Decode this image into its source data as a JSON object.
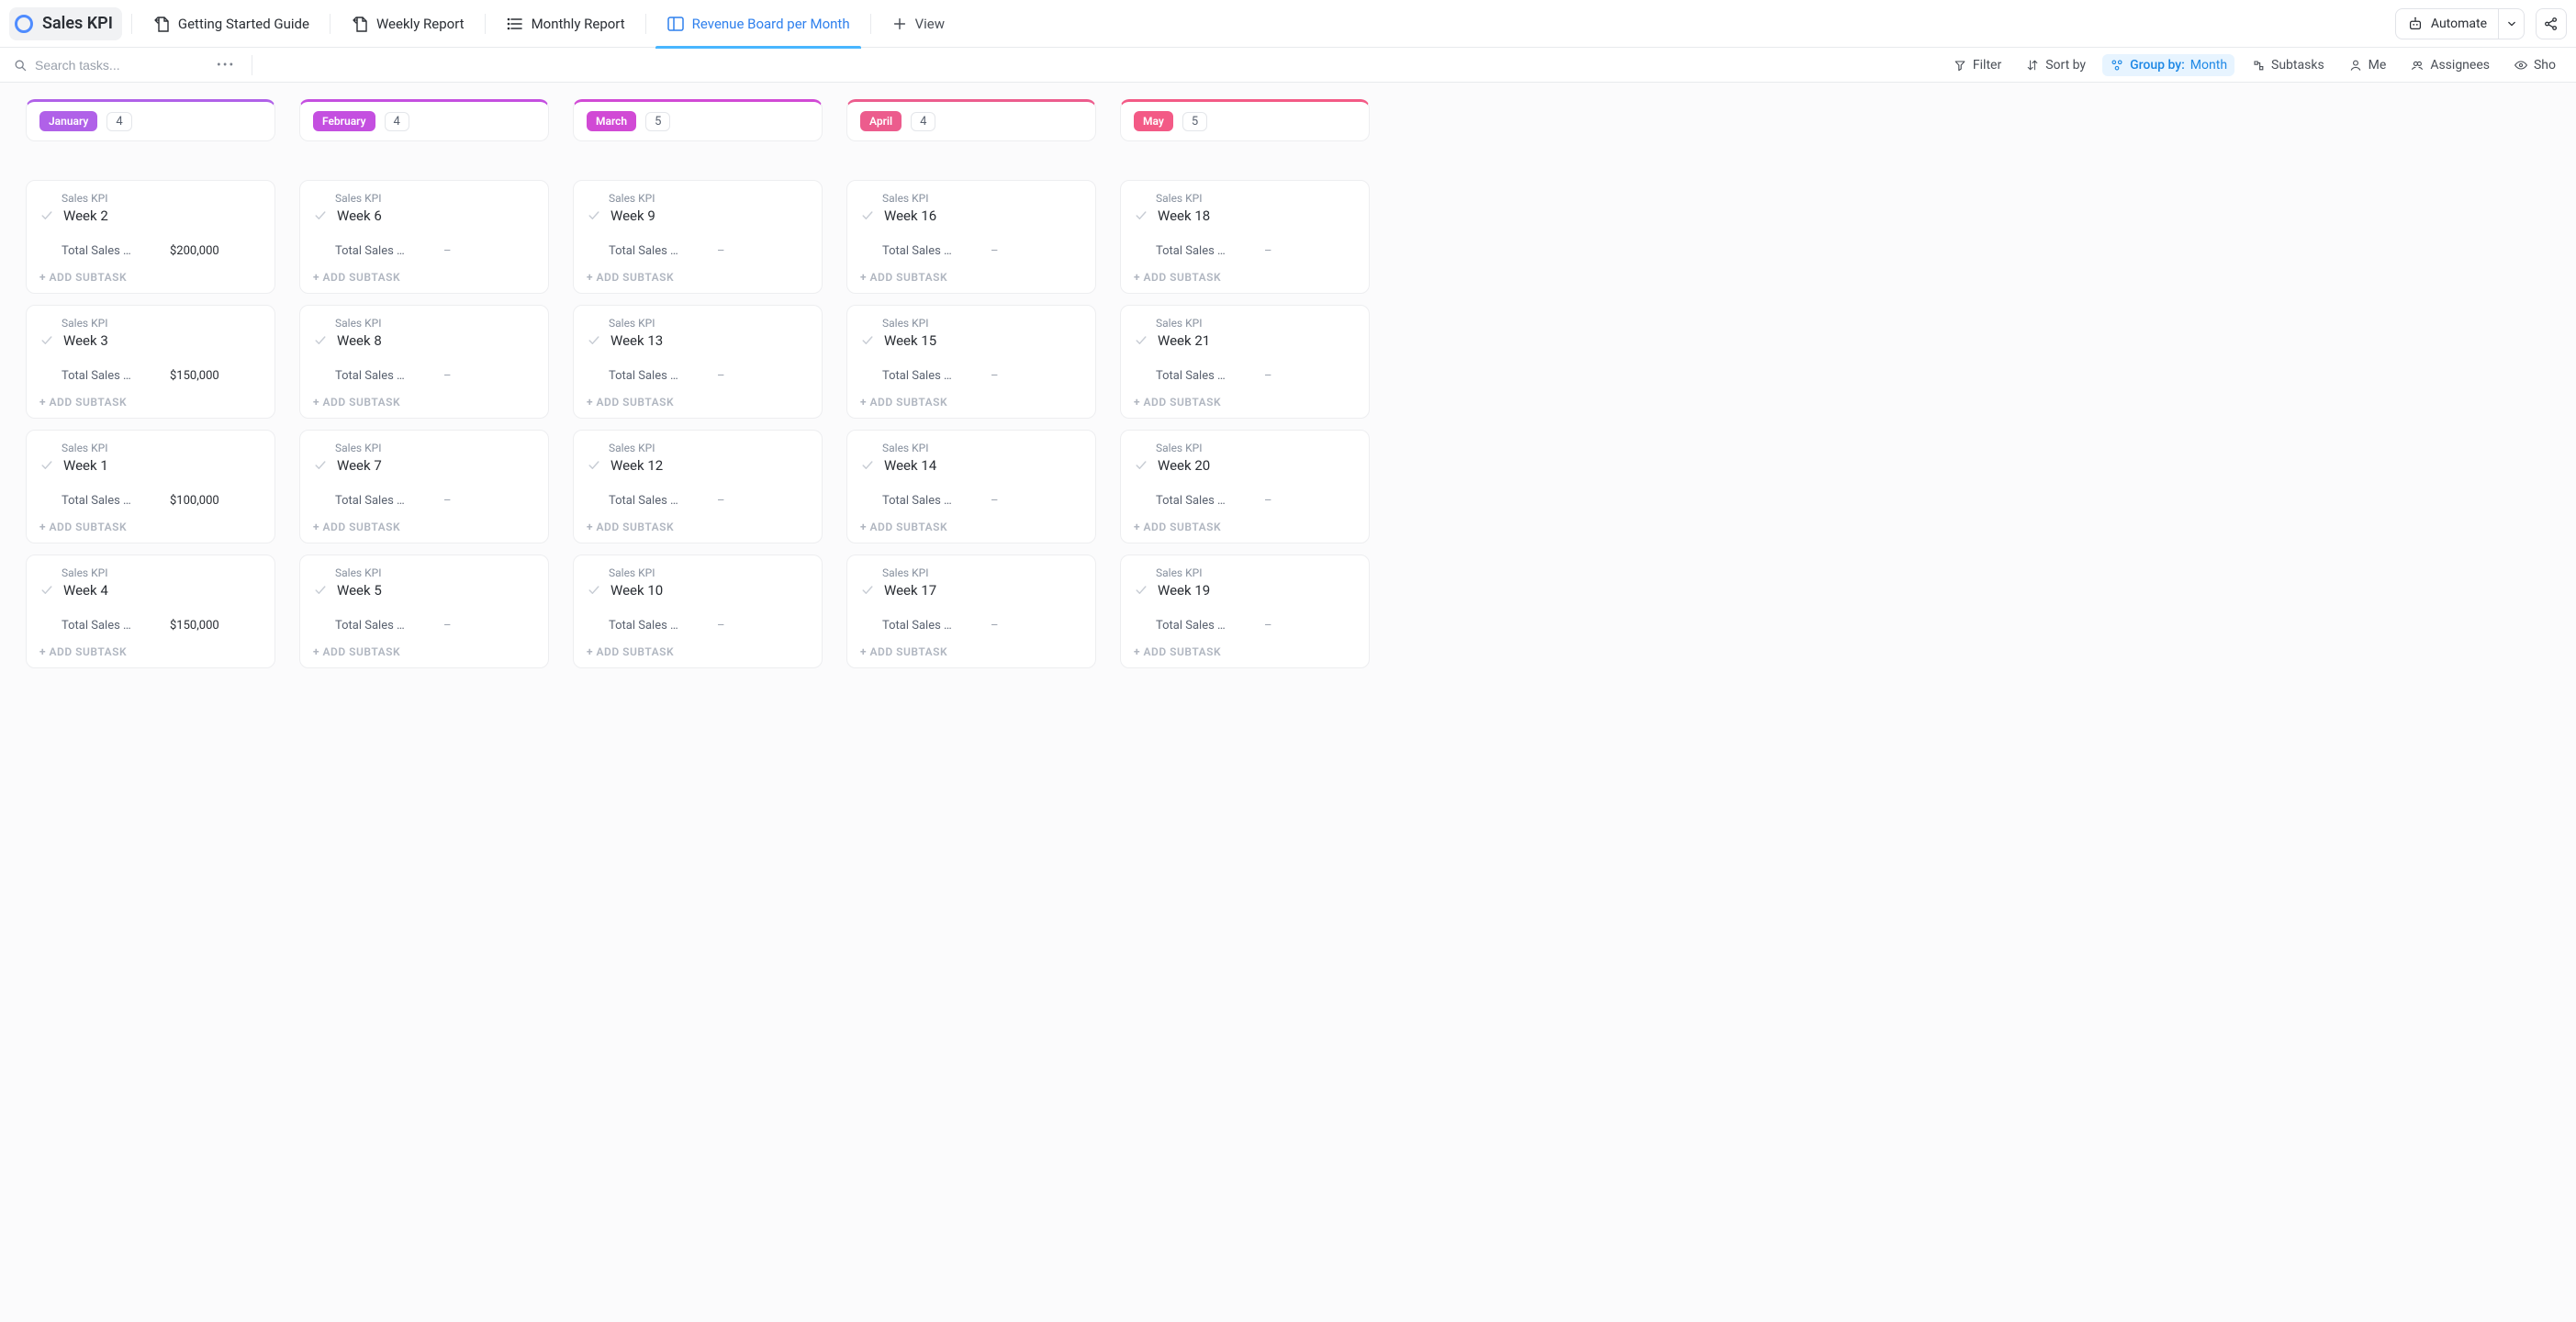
{
  "header": {
    "list_title": "Sales KPI",
    "tabs": [
      {
        "id": "getting-started",
        "label": "Getting Started Guide",
        "icon": "doc"
      },
      {
        "id": "weekly-report",
        "label": "Weekly Report",
        "icon": "doc"
      },
      {
        "id": "monthly-report",
        "label": "Monthly Report",
        "icon": "list"
      },
      {
        "id": "revenue-board",
        "label": "Revenue Board per Month",
        "icon": "board",
        "active": true
      }
    ],
    "view_label": "View",
    "automate_label": "Automate"
  },
  "toolbar": {
    "search_placeholder": "Search tasks...",
    "filter_label": "Filter",
    "sort_label": "Sort by",
    "group_label": "Group by:",
    "group_value": "Month",
    "subtasks_label": "Subtasks",
    "me_label": "Me",
    "assignees_label": "Assignees",
    "show_label": "Sho"
  },
  "card_strings": {
    "project": "Sales KPI",
    "field_label": "Total Sales …",
    "empty": "–",
    "add_subtask": "ADD SUBTASK"
  },
  "columns": [
    {
      "name": "January",
      "color": "#b061e8",
      "count": "4",
      "cards": [
        {
          "title": "Week 2",
          "value": "$200,000"
        },
        {
          "title": "Week 3",
          "value": "$150,000"
        },
        {
          "title": "Week 1",
          "value": "$100,000"
        },
        {
          "title": "Week 4",
          "value": "$150,000"
        }
      ]
    },
    {
      "name": "February",
      "color": "#c44fe0",
      "count": "4",
      "cards": [
        {
          "title": "Week 6",
          "value": ""
        },
        {
          "title": "Week 8",
          "value": ""
        },
        {
          "title": "Week 7",
          "value": ""
        },
        {
          "title": "Week 5",
          "value": ""
        }
      ]
    },
    {
      "name": "March",
      "color": "#d14ad5",
      "count": "5",
      "cards": [
        {
          "title": "Week 9",
          "value": ""
        },
        {
          "title": "Week 13",
          "value": ""
        },
        {
          "title": "Week 12",
          "value": ""
        },
        {
          "title": "Week 10",
          "value": ""
        }
      ]
    },
    {
      "name": "April",
      "color": "#ec5c8d",
      "count": "4",
      "cards": [
        {
          "title": "Week 16",
          "value": ""
        },
        {
          "title": "Week 15",
          "value": ""
        },
        {
          "title": "Week 14",
          "value": ""
        },
        {
          "title": "Week 17",
          "value": ""
        }
      ]
    },
    {
      "name": "May",
      "color": "#f35a86",
      "count": "5",
      "cards": [
        {
          "title": "Week 18",
          "value": ""
        },
        {
          "title": "Week 21",
          "value": ""
        },
        {
          "title": "Week 20",
          "value": ""
        },
        {
          "title": "Week 19",
          "value": ""
        }
      ]
    }
  ]
}
